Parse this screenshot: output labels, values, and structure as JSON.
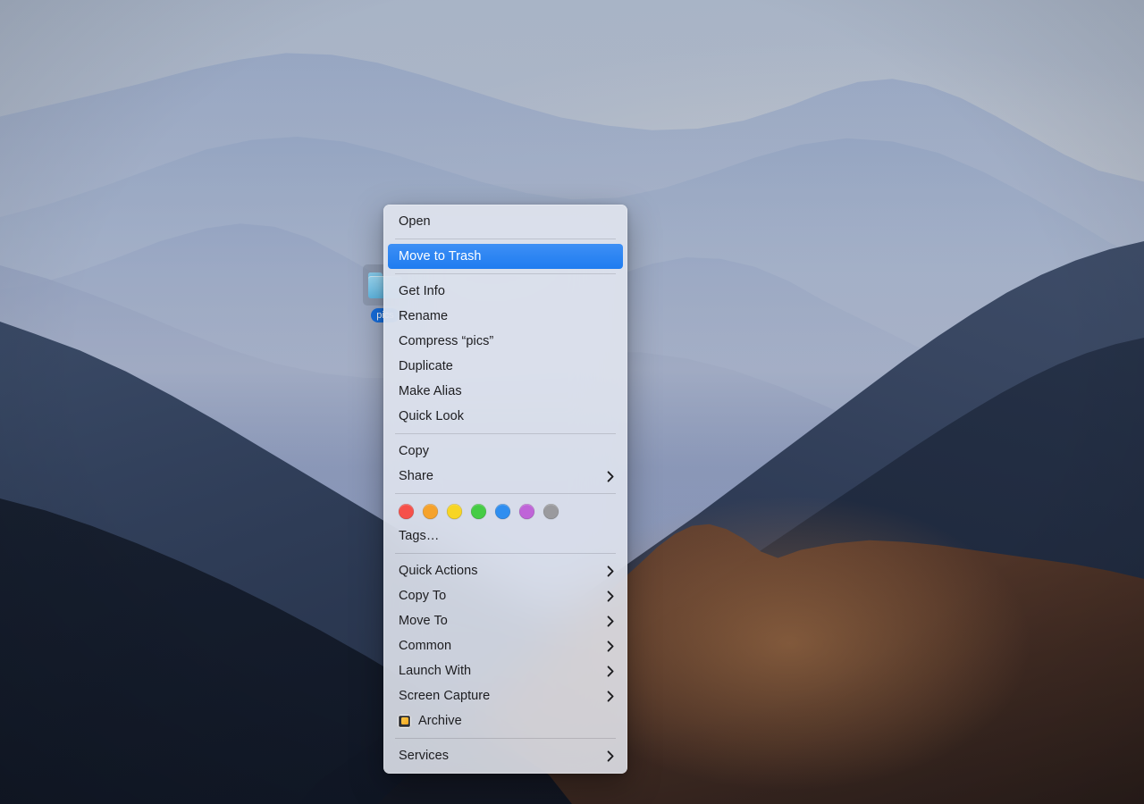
{
  "desktop": {
    "wallpaper_name": "big-sur-mountains",
    "colors": {
      "sky_top": "#a7b3c6",
      "sky_bottom": "#d2cfc8",
      "ridge_far": "#8fa0bf",
      "ridge_mid": "#6f86b2",
      "slope_dark": "#26334c",
      "sunlit_ridge": "#a9744a",
      "foreground_shadow": "#151d2c"
    },
    "folder": {
      "name": "pics",
      "icon": "folder-icon",
      "selected": true,
      "label_color": "#166fe0"
    }
  },
  "context_menu": {
    "name": "finder-context-menu",
    "accent_color": "#1f7cf0",
    "background_color": "#e2e6ee",
    "text_color": "#1d1d20",
    "items": [
      {
        "id": "open",
        "label": "Open",
        "submenu": false,
        "selected": false
      },
      {
        "type": "separator"
      },
      {
        "id": "move-to-trash",
        "label": "Move to Trash",
        "submenu": false,
        "selected": true
      },
      {
        "type": "separator"
      },
      {
        "id": "get-info",
        "label": "Get Info",
        "submenu": false,
        "selected": false
      },
      {
        "id": "rename",
        "label": "Rename",
        "submenu": false,
        "selected": false
      },
      {
        "id": "compress",
        "label": "Compress “pics”",
        "submenu": false,
        "selected": false
      },
      {
        "id": "duplicate",
        "label": "Duplicate",
        "submenu": false,
        "selected": false
      },
      {
        "id": "make-alias",
        "label": "Make Alias",
        "submenu": false,
        "selected": false
      },
      {
        "id": "quick-look",
        "label": "Quick Look",
        "submenu": false,
        "selected": false
      },
      {
        "type": "separator"
      },
      {
        "id": "copy",
        "label": "Copy",
        "submenu": false,
        "selected": false
      },
      {
        "id": "share",
        "label": "Share",
        "submenu": true,
        "selected": false
      },
      {
        "type": "separator"
      },
      {
        "type": "tags"
      },
      {
        "id": "tags",
        "label": "Tags…",
        "submenu": false,
        "selected": false
      },
      {
        "type": "separator"
      },
      {
        "id": "quick-actions",
        "label": "Quick Actions",
        "submenu": true,
        "selected": false
      },
      {
        "id": "copy-to",
        "label": "Copy To",
        "submenu": true,
        "selected": false
      },
      {
        "id": "move-to",
        "label": "Move To",
        "submenu": true,
        "selected": false
      },
      {
        "id": "common",
        "label": "Common",
        "submenu": true,
        "selected": false
      },
      {
        "id": "launch-with",
        "label": "Launch With",
        "submenu": true,
        "selected": false
      },
      {
        "id": "screen-capture",
        "label": "Screen Capture",
        "submenu": true,
        "selected": false
      },
      {
        "id": "archive",
        "label": "Archive",
        "submenu": false,
        "selected": false,
        "icon": "archive-app-icon"
      },
      {
        "type": "separator"
      },
      {
        "id": "services",
        "label": "Services",
        "submenu": true,
        "selected": false
      }
    ],
    "tag_colors": [
      {
        "name": "red",
        "hex": "#f6504a"
      },
      {
        "name": "orange",
        "hex": "#f5a22c"
      },
      {
        "name": "yellow",
        "hex": "#f7d524"
      },
      {
        "name": "green",
        "hex": "#45cc45"
      },
      {
        "name": "blue",
        "hex": "#2f8ef0"
      },
      {
        "name": "purple",
        "hex": "#bf64d8"
      },
      {
        "name": "gray",
        "hex": "#9a9a9e"
      }
    ]
  }
}
